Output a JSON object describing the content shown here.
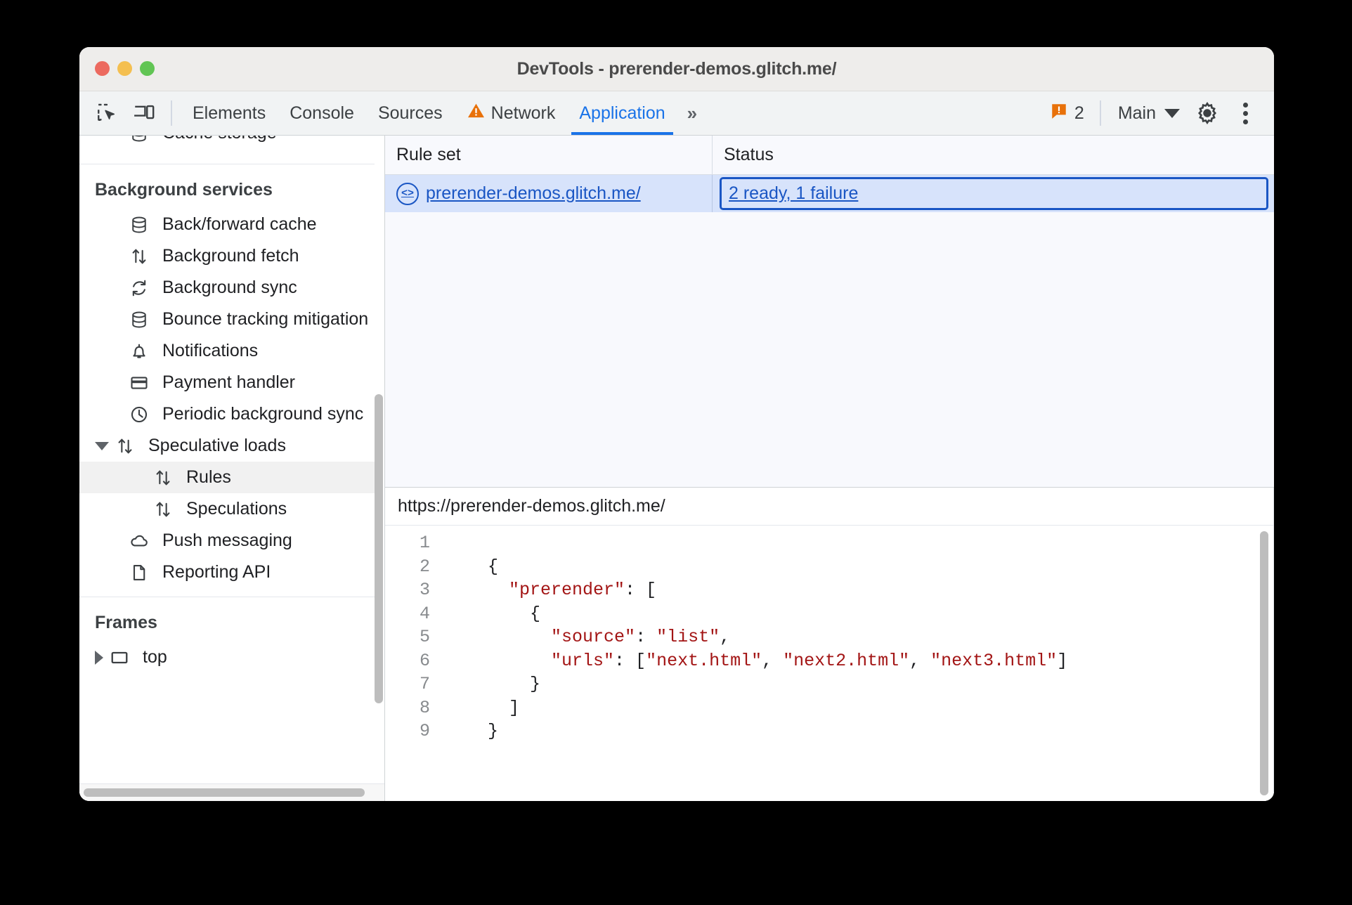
{
  "window": {
    "title": "DevTools - prerender-demos.glitch.me/",
    "traffic_lights": [
      "close-red",
      "minimize-yellow",
      "maximize-green"
    ]
  },
  "toolbar": {
    "inspect_icon": "inspect-element-icon",
    "device_icon": "device-toolbar-icon",
    "tabs": [
      {
        "label": "Elements",
        "active": false,
        "icon": ""
      },
      {
        "label": "Console",
        "active": false,
        "icon": ""
      },
      {
        "label": "Sources",
        "active": false,
        "icon": ""
      },
      {
        "label": "Network",
        "active": false,
        "icon": "warning-triangle-icon"
      },
      {
        "label": "Application",
        "active": true,
        "icon": ""
      }
    ],
    "more_tabs_label": "»",
    "issues_count": "2",
    "issues_icon": "issue-flag-icon",
    "context_label": "Main",
    "settings_icon": "gear-icon",
    "more_options_icon": "kebab-menu-icon",
    "accent_color": "#1a73e8"
  },
  "sidebar": {
    "partial_top_item": {
      "label": "Cache storage",
      "icon": "database-icon"
    },
    "sections": [
      {
        "title": "Background services",
        "items": [
          {
            "label": "Back/forward cache",
            "icon": "database-icon",
            "indent": 1,
            "selected": false,
            "twisty": "none"
          },
          {
            "label": "Background fetch",
            "icon": "updown-arrows-icon",
            "indent": 1,
            "selected": false,
            "twisty": "none"
          },
          {
            "label": "Background sync",
            "icon": "sync-icon",
            "indent": 1,
            "selected": false,
            "twisty": "none"
          },
          {
            "label": "Bounce tracking mitigation",
            "icon": "database-icon",
            "indent": 1,
            "selected": false,
            "twisty": "none"
          },
          {
            "label": "Notifications",
            "icon": "bell-icon",
            "indent": 1,
            "selected": false,
            "twisty": "none"
          },
          {
            "label": "Payment handler",
            "icon": "credit-card-icon",
            "indent": 1,
            "selected": false,
            "twisty": "none"
          },
          {
            "label": "Periodic background sync",
            "icon": "clock-icon",
            "indent": 1,
            "selected": false,
            "twisty": "none"
          },
          {
            "label": "Speculative loads",
            "icon": "updown-arrows-icon",
            "indent": 1,
            "selected": false,
            "twisty": "open"
          },
          {
            "label": "Rules",
            "icon": "updown-arrows-icon",
            "indent": 2,
            "selected": true,
            "twisty": "none"
          },
          {
            "label": "Speculations",
            "icon": "updown-arrows-icon",
            "indent": 2,
            "selected": false,
            "twisty": "none"
          },
          {
            "label": "Push messaging",
            "icon": "cloud-icon",
            "indent": 1,
            "selected": false,
            "twisty": "none"
          },
          {
            "label": "Reporting API",
            "icon": "document-icon",
            "indent": 1,
            "selected": false,
            "twisty": "none"
          }
        ]
      },
      {
        "title": "Frames",
        "items": [
          {
            "label": "top",
            "icon": "frame-icon",
            "indent": 1,
            "selected": false,
            "twisty": "closed"
          }
        ]
      }
    ]
  },
  "main": {
    "grid": {
      "columns": [
        "Rule set",
        "Status"
      ],
      "rows": [
        {
          "rule_set": "prerender-demos.glitch.me/",
          "rule_set_icon": "source-code-icon",
          "status": "2 ready, 1 failure",
          "selected": true,
          "status_focused": true
        }
      ]
    },
    "detail": {
      "url": "https://prerender-demos.glitch.me/",
      "code_lines": [
        {
          "n": "1",
          "segments": []
        },
        {
          "n": "2",
          "segments": [
            {
              "t": "    {",
              "c": "plain"
            }
          ]
        },
        {
          "n": "3",
          "segments": [
            {
              "t": "      ",
              "c": "plain"
            },
            {
              "t": "\"prerender\"",
              "c": "string"
            },
            {
              "t": ": [",
              "c": "plain"
            }
          ]
        },
        {
          "n": "4",
          "segments": [
            {
              "t": "        {",
              "c": "plain"
            }
          ]
        },
        {
          "n": "5",
          "segments": [
            {
              "t": "          ",
              "c": "plain"
            },
            {
              "t": "\"source\"",
              "c": "string"
            },
            {
              "t": ": ",
              "c": "plain"
            },
            {
              "t": "\"list\"",
              "c": "string"
            },
            {
              "t": ",",
              "c": "plain"
            }
          ]
        },
        {
          "n": "6",
          "segments": [
            {
              "t": "          ",
              "c": "plain"
            },
            {
              "t": "\"urls\"",
              "c": "string"
            },
            {
              "t": ": [",
              "c": "plain"
            },
            {
              "t": "\"next.html\"",
              "c": "string"
            },
            {
              "t": ", ",
              "c": "plain"
            },
            {
              "t": "\"next2.html\"",
              "c": "string"
            },
            {
              "t": ", ",
              "c": "plain"
            },
            {
              "t": "\"next3.html\"",
              "c": "string"
            },
            {
              "t": "]",
              "c": "plain"
            }
          ]
        },
        {
          "n": "7",
          "segments": [
            {
              "t": "        }",
              "c": "plain"
            }
          ]
        },
        {
          "n": "8",
          "segments": [
            {
              "t": "      ]",
              "c": "plain"
            }
          ]
        },
        {
          "n": "9",
          "segments": [
            {
              "t": "    }",
              "c": "plain"
            }
          ]
        }
      ]
    }
  },
  "colors": {
    "link": "#1a56c4",
    "selection": "#d7e3fb",
    "accent": "#1a73e8",
    "warning": "#e8710a",
    "string": "#a31515"
  }
}
